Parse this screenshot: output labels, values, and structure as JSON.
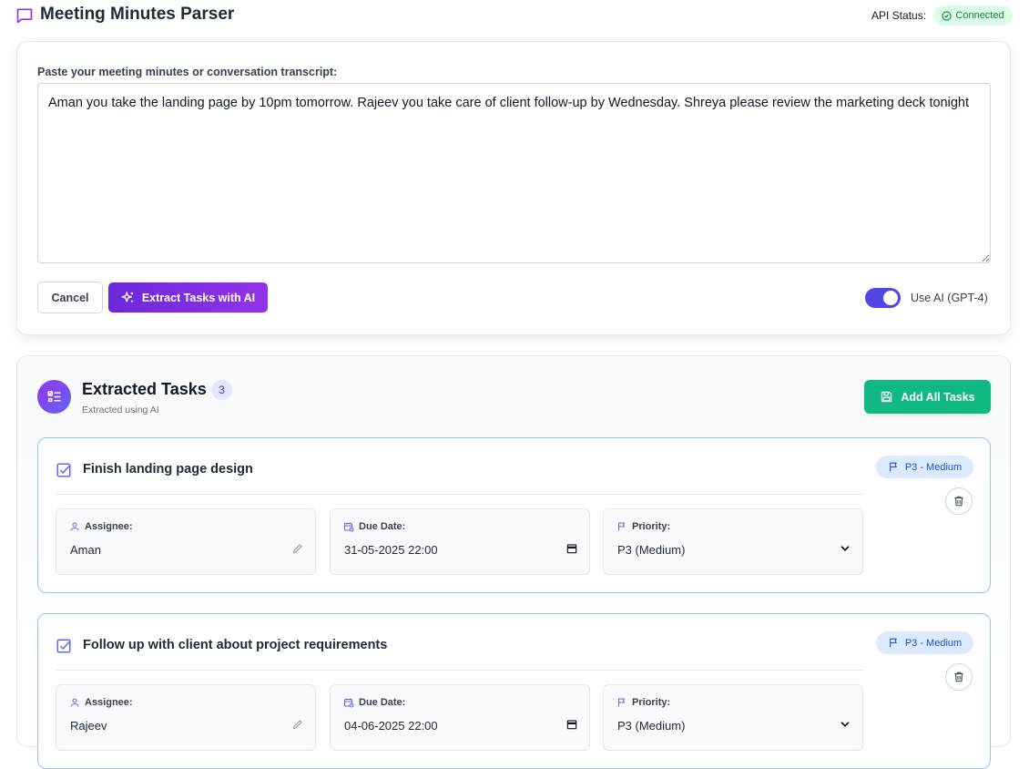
{
  "header": {
    "title": "Meeting Minutes Parser",
    "api_label": "API Status:",
    "api_status": "Connected"
  },
  "input": {
    "label": "Paste your meeting minutes or conversation transcript:",
    "transcript": "Aman you take the landing page by 10pm tomorrow. Rajeev you take care of client follow-up by Wednesday. Shreya please review the marketing deck tonight",
    "cancel_label": "Cancel",
    "extract_label": "Extract Tasks with AI",
    "toggle_label": "Use AI (GPT-4)",
    "toggle_on": true
  },
  "tasks_panel": {
    "title": "Extracted Tasks",
    "count": "3",
    "subtitle": "Extracted using AI",
    "add_all_label": "Add All Tasks"
  },
  "field_labels": {
    "assignee": "Assignee:",
    "due_date": "Due Date:",
    "priority": "Priority:"
  },
  "tasks": [
    {
      "title": "Finish landing page design",
      "badge": "P3 - Medium",
      "assignee": "Aman",
      "due_date": "31-05-2025 22:00",
      "priority": "P3 (Medium)"
    },
    {
      "title": "Follow up with client about project requirements",
      "badge": "P3 - Medium",
      "assignee": "Rajeev",
      "due_date": "04-06-2025 22:00",
      "priority": "P3 (Medium)"
    }
  ],
  "colors": {
    "accent_purple": "#9333ea",
    "accent_indigo": "#4f46e5",
    "success_green": "#10b981",
    "task_border": "#93c5fd"
  }
}
